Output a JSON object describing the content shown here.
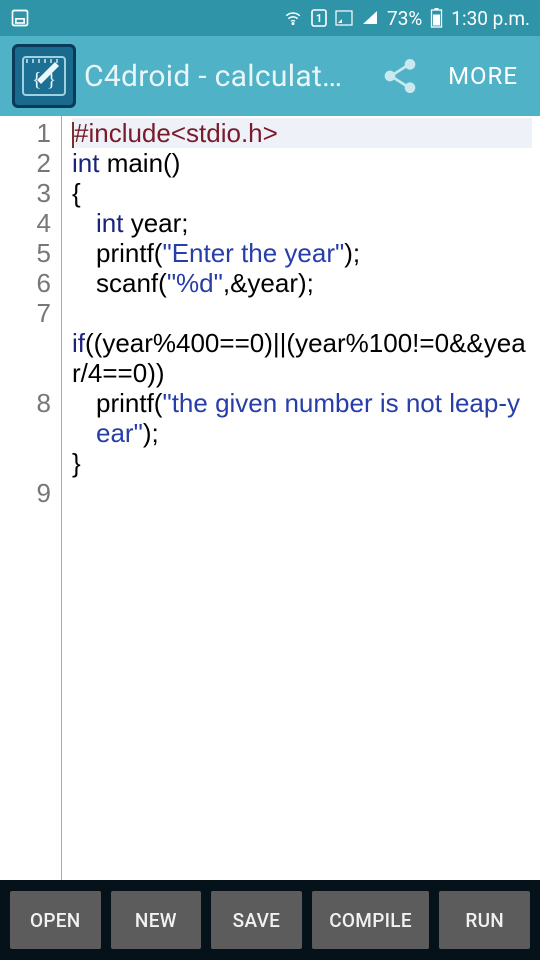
{
  "status": {
    "battery_pct": "73%",
    "time": "1:30 p.m."
  },
  "toolbar": {
    "title": "C4droid - calculat…",
    "more_label": "MORE"
  },
  "editor": {
    "gutter": [
      "1",
      "2",
      "3",
      "4",
      "5",
      "6",
      "7",
      "",
      "8",
      "9"
    ],
    "line1_pre": "#include<stdio.h>",
    "line2_kw": "int",
    "line2_rest": " main()",
    "line3": "{",
    "line4_kw": "int",
    "line4_rest": " year;",
    "line5_pre": "printf(",
    "line5_str": "\"Enter the year\"",
    "line5_post": ");",
    "line6_pre": "scanf(",
    "line6_str": "\"%d\"",
    "line6_post": ",&year);",
    "line7": "",
    "line_if_a": "if",
    "line_if_b": "((year%",
    "line_if_c": "400",
    "line_if_d": "==",
    "line_if_e": "0",
    "line_if_f": ")||(year%",
    "line_if_g": "100",
    "line_if_h": "!=",
    "line_if_i": "0",
    "line_if_j": "&&year/",
    "line_if_k": "4",
    "line_if_l": "==",
    "line_if_m": "0",
    "line_if_n": "))",
    "line8_pre": "printf(",
    "line8_str": "\"the given number is not leap-year\"",
    "line8_post": ");",
    "line9": "}"
  },
  "bottom": {
    "open": "OPEN",
    "new": "NEW",
    "save": "SAVE",
    "compile": "COMPILE",
    "run": "RUN"
  }
}
